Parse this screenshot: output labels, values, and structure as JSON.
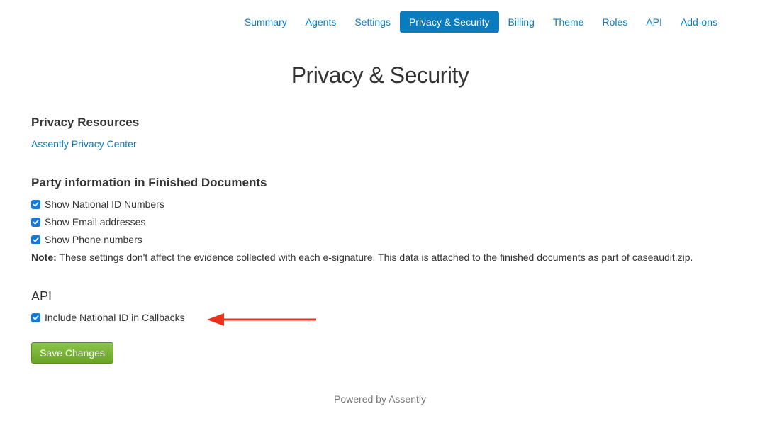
{
  "nav": {
    "items": [
      {
        "label": "Summary",
        "active": false
      },
      {
        "label": "Agents",
        "active": false
      },
      {
        "label": "Settings",
        "active": false
      },
      {
        "label": "Privacy & Security",
        "active": true
      },
      {
        "label": "Billing",
        "active": false
      },
      {
        "label": "Theme",
        "active": false
      },
      {
        "label": "Roles",
        "active": false
      },
      {
        "label": "API",
        "active": false
      },
      {
        "label": "Add-ons",
        "active": false
      }
    ]
  },
  "page": {
    "title": "Privacy & Security"
  },
  "privacy_resources": {
    "heading": "Privacy Resources",
    "link_label": "Assently Privacy Center"
  },
  "party_info": {
    "heading": "Party information in Finished Documents",
    "options": [
      {
        "label": "Show National ID Numbers",
        "checked": true
      },
      {
        "label": "Show Email addresses",
        "checked": true
      },
      {
        "label": "Show Phone numbers",
        "checked": true
      }
    ],
    "note_label": "Note:",
    "note_text": " These settings don't affect the evidence collected with each e-signature. This data is attached to the finished documents as part of caseaudit.zip."
  },
  "api": {
    "heading": "API",
    "option": {
      "label": "Include National ID in Callbacks",
      "checked": true
    }
  },
  "actions": {
    "save_label": "Save Changes"
  },
  "footer": {
    "text": "Powered by Assently"
  },
  "colors": {
    "accent": "#0a7bbd",
    "checkbox": "#1479d6",
    "save_button": "#7cb83a",
    "annotation_arrow": "#e8321e"
  },
  "icons": {
    "checkbox": "checkmark-icon",
    "annotation": "red-arrow-left-icon"
  }
}
